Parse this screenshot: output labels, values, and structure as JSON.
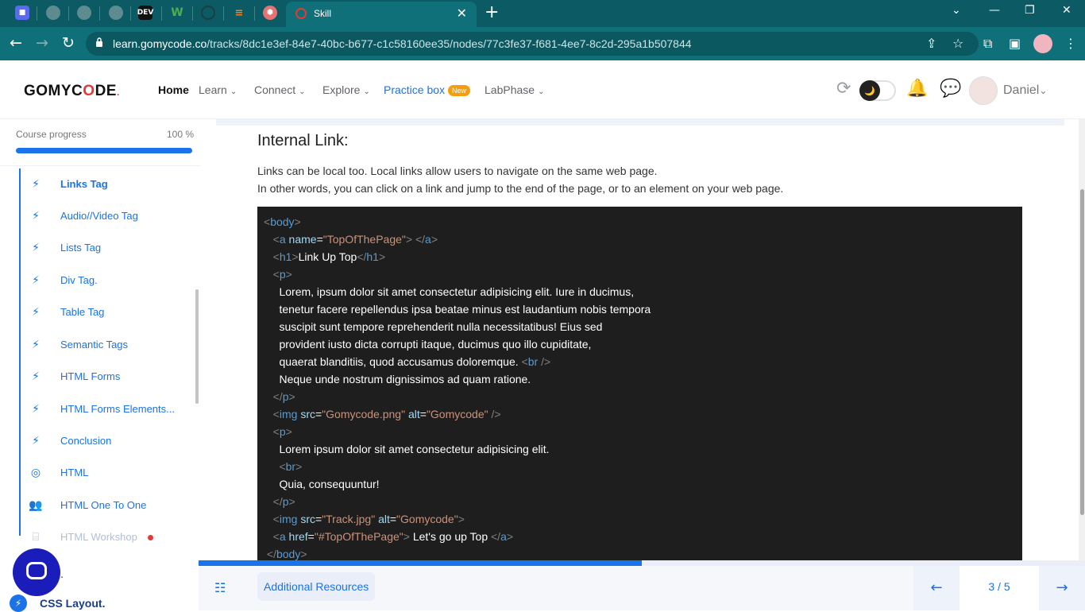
{
  "browser": {
    "tabs": [
      {
        "icon": "app-icon"
      },
      {
        "icon": "globe-icon"
      },
      {
        "icon": "globe-icon"
      },
      {
        "icon": "globe-icon"
      },
      {
        "icon": "dev-icon",
        "text": "DEV"
      },
      {
        "icon": "w-icon",
        "text": "W"
      },
      {
        "icon": "github-icon"
      },
      {
        "icon": "stackoverflow-icon"
      },
      {
        "icon": "shield-icon"
      }
    ],
    "active_tab_title": "Skill",
    "url_host": "learn.gomycode.co",
    "url_path": "/tracks/8dc1e3ef-84e7-40bc-b677-c1c58160ee35/nodes/77c3fe37-f681-4ee7-8c2d-295a1b507844"
  },
  "header": {
    "logo_pre": "GOMYC",
    "logo_o": "O",
    "logo_post": "DE",
    "logo_mark": ".",
    "nav": {
      "home": "Home",
      "learn": "Learn",
      "connect": "Connect",
      "explore": "Explore",
      "practice": "Practice box",
      "practice_badge": "New",
      "labphase": "LabPhase"
    },
    "user_name": "Daniel"
  },
  "sidebar": {
    "progress_label": "Course progress",
    "progress_value": "100 %",
    "progress_fraction": 1.0,
    "items": [
      {
        "label": "Links Tag",
        "icon": "bolt-icon",
        "active": true
      },
      {
        "label": "Audio//Video Tag",
        "icon": "bolt-icon"
      },
      {
        "label": "Lists Tag",
        "icon": "bolt-icon"
      },
      {
        "label": "Div Tag.",
        "icon": "bolt-icon"
      },
      {
        "label": "Table Tag",
        "icon": "bolt-icon"
      },
      {
        "label": "Semantic Tags",
        "icon": "bolt-icon"
      },
      {
        "label": "HTML Forms",
        "icon": "bolt-icon"
      },
      {
        "label": "HTML Forms Elements...",
        "icon": "bolt-icon"
      },
      {
        "label": "Conclusion",
        "icon": "bolt-icon"
      },
      {
        "label": "HTML",
        "icon": "target-icon"
      },
      {
        "label": "HTML One To One",
        "icon": "people-icon"
      },
      {
        "label": "HTML Workshop",
        "icon": "workshop-icon",
        "faded": true,
        "dot": true
      }
    ],
    "partial_label": ".",
    "next_section": "CSS Layout."
  },
  "content": {
    "title": "Internal Link:",
    "para1": "Links can be local too. Local links allow users to navigate on the same web page.",
    "para2": "In other words, you can click on a link and jump to the end of the page, or to an element on your web page.",
    "code": {
      "l1_tag": "body",
      "l2_tag": "a",
      "l2_attr": "name",
      "l2_val": "\"TopOfThePage\"",
      "l2_close": "a",
      "l3_tag": "h1",
      "l3_text": "Link Up Top",
      "l3_close": "h1",
      "l4_tag": "p",
      "l5": "Lorem, ipsum dolor sit amet consectetur adipisicing elit. Iure in ducimus,",
      "l6": "tenetur facere repellendus ipsa beatae minus est laudantium nobis tempora",
      "l7": "suscipit sunt tempore reprehenderit nulla necessitatibus! Eius sed",
      "l8": "provident iusto dicta corrupti itaque, ducimus quo illo cupiditate,",
      "l9_text": "quaerat blanditiis, quod accusamus doloremque.",
      "l9_tag": "br",
      "l10": "Neque unde nostrum dignissimos ad quam ratione.",
      "l11_close": "p",
      "l12_tag": "img",
      "l12_attr1": "src",
      "l12_val1": "\"Gomycode.png\"",
      "l12_attr2": "alt",
      "l12_val2": "\"Gomycode\"",
      "l13_tag": "p",
      "l14": "Lorem ipsum dolor sit amet consectetur adipisicing elit.",
      "l15_tag": "br",
      "l16": "Quia, consequuntur!",
      "l17_close": "p",
      "l18_tag": "img",
      "l18_attr1": "src",
      "l18_val1": "\"Track.jpg\"",
      "l18_attr2": "alt",
      "l18_val2": "\"Gomycode\"",
      "l19_tag": "a",
      "l19_attr": "href",
      "l19_val": "\"#TopOfThePage\"",
      "l19_text": " Let's go up Top ",
      "l19_close": "a",
      "l20_close": "body"
    }
  },
  "footer": {
    "additional_resources": "Additional Resources",
    "page_indicator": "3 / 5",
    "progress_fraction": 0.5
  },
  "colors": {
    "brand_blue": "#1a73e8",
    "browser_teal": "#0f7079",
    "code_bg": "#1e1e1e",
    "logo_red": "#e53935"
  }
}
